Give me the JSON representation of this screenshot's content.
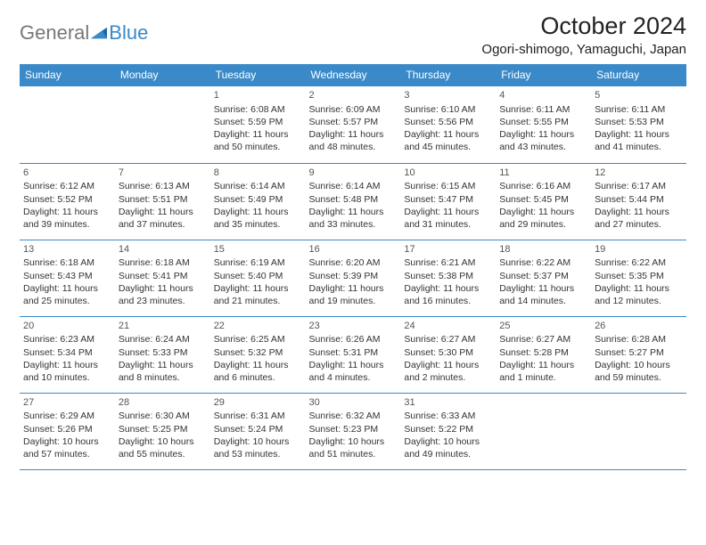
{
  "logo": {
    "part1": "General",
    "part2": "Blue"
  },
  "title": "October 2024",
  "location": "Ogori-shimogo, Yamaguchi, Japan",
  "weekdays": [
    "Sunday",
    "Monday",
    "Tuesday",
    "Wednesday",
    "Thursday",
    "Friday",
    "Saturday"
  ],
  "weeks": [
    [
      null,
      null,
      {
        "day": "1",
        "sunrise": "Sunrise: 6:08 AM",
        "sunset": "Sunset: 5:59 PM",
        "daylight1": "Daylight: 11 hours",
        "daylight2": "and 50 minutes."
      },
      {
        "day": "2",
        "sunrise": "Sunrise: 6:09 AM",
        "sunset": "Sunset: 5:57 PM",
        "daylight1": "Daylight: 11 hours",
        "daylight2": "and 48 minutes."
      },
      {
        "day": "3",
        "sunrise": "Sunrise: 6:10 AM",
        "sunset": "Sunset: 5:56 PM",
        "daylight1": "Daylight: 11 hours",
        "daylight2": "and 45 minutes."
      },
      {
        "day": "4",
        "sunrise": "Sunrise: 6:11 AM",
        "sunset": "Sunset: 5:55 PM",
        "daylight1": "Daylight: 11 hours",
        "daylight2": "and 43 minutes."
      },
      {
        "day": "5",
        "sunrise": "Sunrise: 6:11 AM",
        "sunset": "Sunset: 5:53 PM",
        "daylight1": "Daylight: 11 hours",
        "daylight2": "and 41 minutes."
      }
    ],
    [
      {
        "day": "6",
        "sunrise": "Sunrise: 6:12 AM",
        "sunset": "Sunset: 5:52 PM",
        "daylight1": "Daylight: 11 hours",
        "daylight2": "and 39 minutes."
      },
      {
        "day": "7",
        "sunrise": "Sunrise: 6:13 AM",
        "sunset": "Sunset: 5:51 PM",
        "daylight1": "Daylight: 11 hours",
        "daylight2": "and 37 minutes."
      },
      {
        "day": "8",
        "sunrise": "Sunrise: 6:14 AM",
        "sunset": "Sunset: 5:49 PM",
        "daylight1": "Daylight: 11 hours",
        "daylight2": "and 35 minutes."
      },
      {
        "day": "9",
        "sunrise": "Sunrise: 6:14 AM",
        "sunset": "Sunset: 5:48 PM",
        "daylight1": "Daylight: 11 hours",
        "daylight2": "and 33 minutes."
      },
      {
        "day": "10",
        "sunrise": "Sunrise: 6:15 AM",
        "sunset": "Sunset: 5:47 PM",
        "daylight1": "Daylight: 11 hours",
        "daylight2": "and 31 minutes."
      },
      {
        "day": "11",
        "sunrise": "Sunrise: 6:16 AM",
        "sunset": "Sunset: 5:45 PM",
        "daylight1": "Daylight: 11 hours",
        "daylight2": "and 29 minutes."
      },
      {
        "day": "12",
        "sunrise": "Sunrise: 6:17 AM",
        "sunset": "Sunset: 5:44 PM",
        "daylight1": "Daylight: 11 hours",
        "daylight2": "and 27 minutes."
      }
    ],
    [
      {
        "day": "13",
        "sunrise": "Sunrise: 6:18 AM",
        "sunset": "Sunset: 5:43 PM",
        "daylight1": "Daylight: 11 hours",
        "daylight2": "and 25 minutes."
      },
      {
        "day": "14",
        "sunrise": "Sunrise: 6:18 AM",
        "sunset": "Sunset: 5:41 PM",
        "daylight1": "Daylight: 11 hours",
        "daylight2": "and 23 minutes."
      },
      {
        "day": "15",
        "sunrise": "Sunrise: 6:19 AM",
        "sunset": "Sunset: 5:40 PM",
        "daylight1": "Daylight: 11 hours",
        "daylight2": "and 21 minutes."
      },
      {
        "day": "16",
        "sunrise": "Sunrise: 6:20 AM",
        "sunset": "Sunset: 5:39 PM",
        "daylight1": "Daylight: 11 hours",
        "daylight2": "and 19 minutes."
      },
      {
        "day": "17",
        "sunrise": "Sunrise: 6:21 AM",
        "sunset": "Sunset: 5:38 PM",
        "daylight1": "Daylight: 11 hours",
        "daylight2": "and 16 minutes."
      },
      {
        "day": "18",
        "sunrise": "Sunrise: 6:22 AM",
        "sunset": "Sunset: 5:37 PM",
        "daylight1": "Daylight: 11 hours",
        "daylight2": "and 14 minutes."
      },
      {
        "day": "19",
        "sunrise": "Sunrise: 6:22 AM",
        "sunset": "Sunset: 5:35 PM",
        "daylight1": "Daylight: 11 hours",
        "daylight2": "and 12 minutes."
      }
    ],
    [
      {
        "day": "20",
        "sunrise": "Sunrise: 6:23 AM",
        "sunset": "Sunset: 5:34 PM",
        "daylight1": "Daylight: 11 hours",
        "daylight2": "and 10 minutes."
      },
      {
        "day": "21",
        "sunrise": "Sunrise: 6:24 AM",
        "sunset": "Sunset: 5:33 PM",
        "daylight1": "Daylight: 11 hours",
        "daylight2": "and 8 minutes."
      },
      {
        "day": "22",
        "sunrise": "Sunrise: 6:25 AM",
        "sunset": "Sunset: 5:32 PM",
        "daylight1": "Daylight: 11 hours",
        "daylight2": "and 6 minutes."
      },
      {
        "day": "23",
        "sunrise": "Sunrise: 6:26 AM",
        "sunset": "Sunset: 5:31 PM",
        "daylight1": "Daylight: 11 hours",
        "daylight2": "and 4 minutes."
      },
      {
        "day": "24",
        "sunrise": "Sunrise: 6:27 AM",
        "sunset": "Sunset: 5:30 PM",
        "daylight1": "Daylight: 11 hours",
        "daylight2": "and 2 minutes."
      },
      {
        "day": "25",
        "sunrise": "Sunrise: 6:27 AM",
        "sunset": "Sunset: 5:28 PM",
        "daylight1": "Daylight: 11 hours",
        "daylight2": "and 1 minute."
      },
      {
        "day": "26",
        "sunrise": "Sunrise: 6:28 AM",
        "sunset": "Sunset: 5:27 PM",
        "daylight1": "Daylight: 10 hours",
        "daylight2": "and 59 minutes."
      }
    ],
    [
      {
        "day": "27",
        "sunrise": "Sunrise: 6:29 AM",
        "sunset": "Sunset: 5:26 PM",
        "daylight1": "Daylight: 10 hours",
        "daylight2": "and 57 minutes."
      },
      {
        "day": "28",
        "sunrise": "Sunrise: 6:30 AM",
        "sunset": "Sunset: 5:25 PM",
        "daylight1": "Daylight: 10 hours",
        "daylight2": "and 55 minutes."
      },
      {
        "day": "29",
        "sunrise": "Sunrise: 6:31 AM",
        "sunset": "Sunset: 5:24 PM",
        "daylight1": "Daylight: 10 hours",
        "daylight2": "and 53 minutes."
      },
      {
        "day": "30",
        "sunrise": "Sunrise: 6:32 AM",
        "sunset": "Sunset: 5:23 PM",
        "daylight1": "Daylight: 10 hours",
        "daylight2": "and 51 minutes."
      },
      {
        "day": "31",
        "sunrise": "Sunrise: 6:33 AM",
        "sunset": "Sunset: 5:22 PM",
        "daylight1": "Daylight: 10 hours",
        "daylight2": "and 49 minutes."
      },
      null,
      null
    ]
  ]
}
